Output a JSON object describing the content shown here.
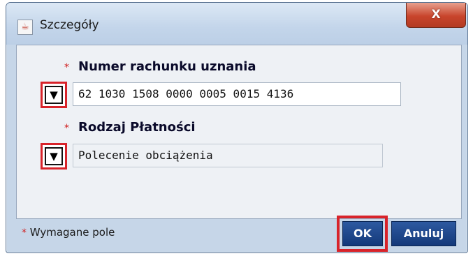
{
  "window": {
    "title": "Szczegóły",
    "close_label": "X"
  },
  "form": {
    "fields": [
      {
        "required_marker": "*",
        "label": "Numer rachunku uznania",
        "dropdown_glyph": "▼",
        "value": "62 1030 1508 0000 0005 0015 4136"
      },
      {
        "required_marker": "*",
        "label": "Rodzaj Płatności",
        "dropdown_glyph": "▼",
        "value": "Polecenie obciążenia"
      }
    ]
  },
  "footer": {
    "required_marker": "*",
    "required_note": "Wymagane pole",
    "ok_label": "OK",
    "cancel_label": "Anuluj"
  },
  "colors": {
    "highlight": "#d8232a",
    "button": "#1e4a8e",
    "close": "#c8452c"
  }
}
